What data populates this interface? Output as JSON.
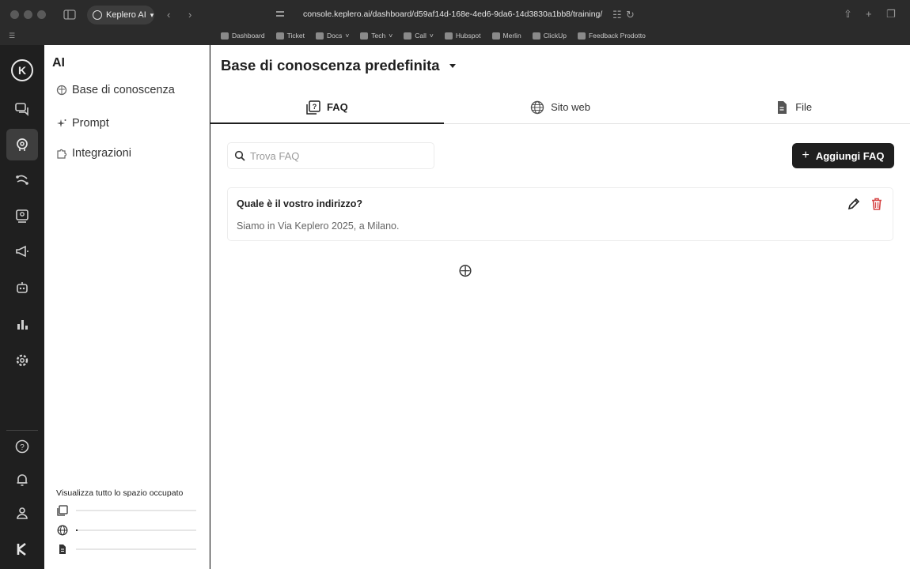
{
  "browser": {
    "tab_title": "Keplero AI",
    "url": "console.keplero.ai/dashboard/d59af14d-168e-4ed6-9da6-14d3830a1bb8/training/",
    "bookmarks": [
      "Dashboard",
      "Ticket",
      "Docs",
      "Tech",
      "Call",
      "Hubspot",
      "Merlin",
      "ClickUp",
      "Feedback Prodotto"
    ]
  },
  "rail": {
    "logo": "K",
    "items": [
      "chat-icon",
      "ai-brain-icon",
      "workflow-icon",
      "contacts-icon",
      "megaphone-icon",
      "bot-icon",
      "analytics-icon",
      "settings-icon"
    ],
    "bottom": [
      "help-icon",
      "bell-icon",
      "user-icon",
      "keplero-icon"
    ]
  },
  "sidebar": {
    "title": "AI",
    "items": [
      {
        "label": "Base di conoscenza",
        "icon": "brain-icon"
      },
      {
        "label": "Prompt",
        "icon": "sparkle-icon"
      },
      {
        "label": "Integrazioni",
        "icon": "puzzle-icon"
      }
    ],
    "usage_title": "Visualizza tutto lo spazio occupato",
    "usage": [
      {
        "icon": "faq-icon",
        "fill": 0.0
      },
      {
        "icon": "globe-icon",
        "fill": 0.01
      },
      {
        "icon": "file-icon",
        "fill": 0.0
      }
    ]
  },
  "main": {
    "title": "Base di conoscenza predefinita",
    "tabs": [
      {
        "label": "FAQ",
        "icon": "faq-icon",
        "active": true
      },
      {
        "label": "Sito web",
        "icon": "globe-icon",
        "active": false
      },
      {
        "label": "File",
        "icon": "file-icon",
        "active": false
      }
    ],
    "search_placeholder": "Trova FAQ",
    "add_button": "Aggiungi FAQ",
    "faqs": [
      {
        "question": "Quale è il vostro indirizzo?",
        "answer": "Siamo in Via Keplero 2025, a Milano."
      }
    ]
  },
  "colors": {
    "accent": "#1f1f1f",
    "danger": "#d64545",
    "rail_bg": "#1f1f1f"
  }
}
